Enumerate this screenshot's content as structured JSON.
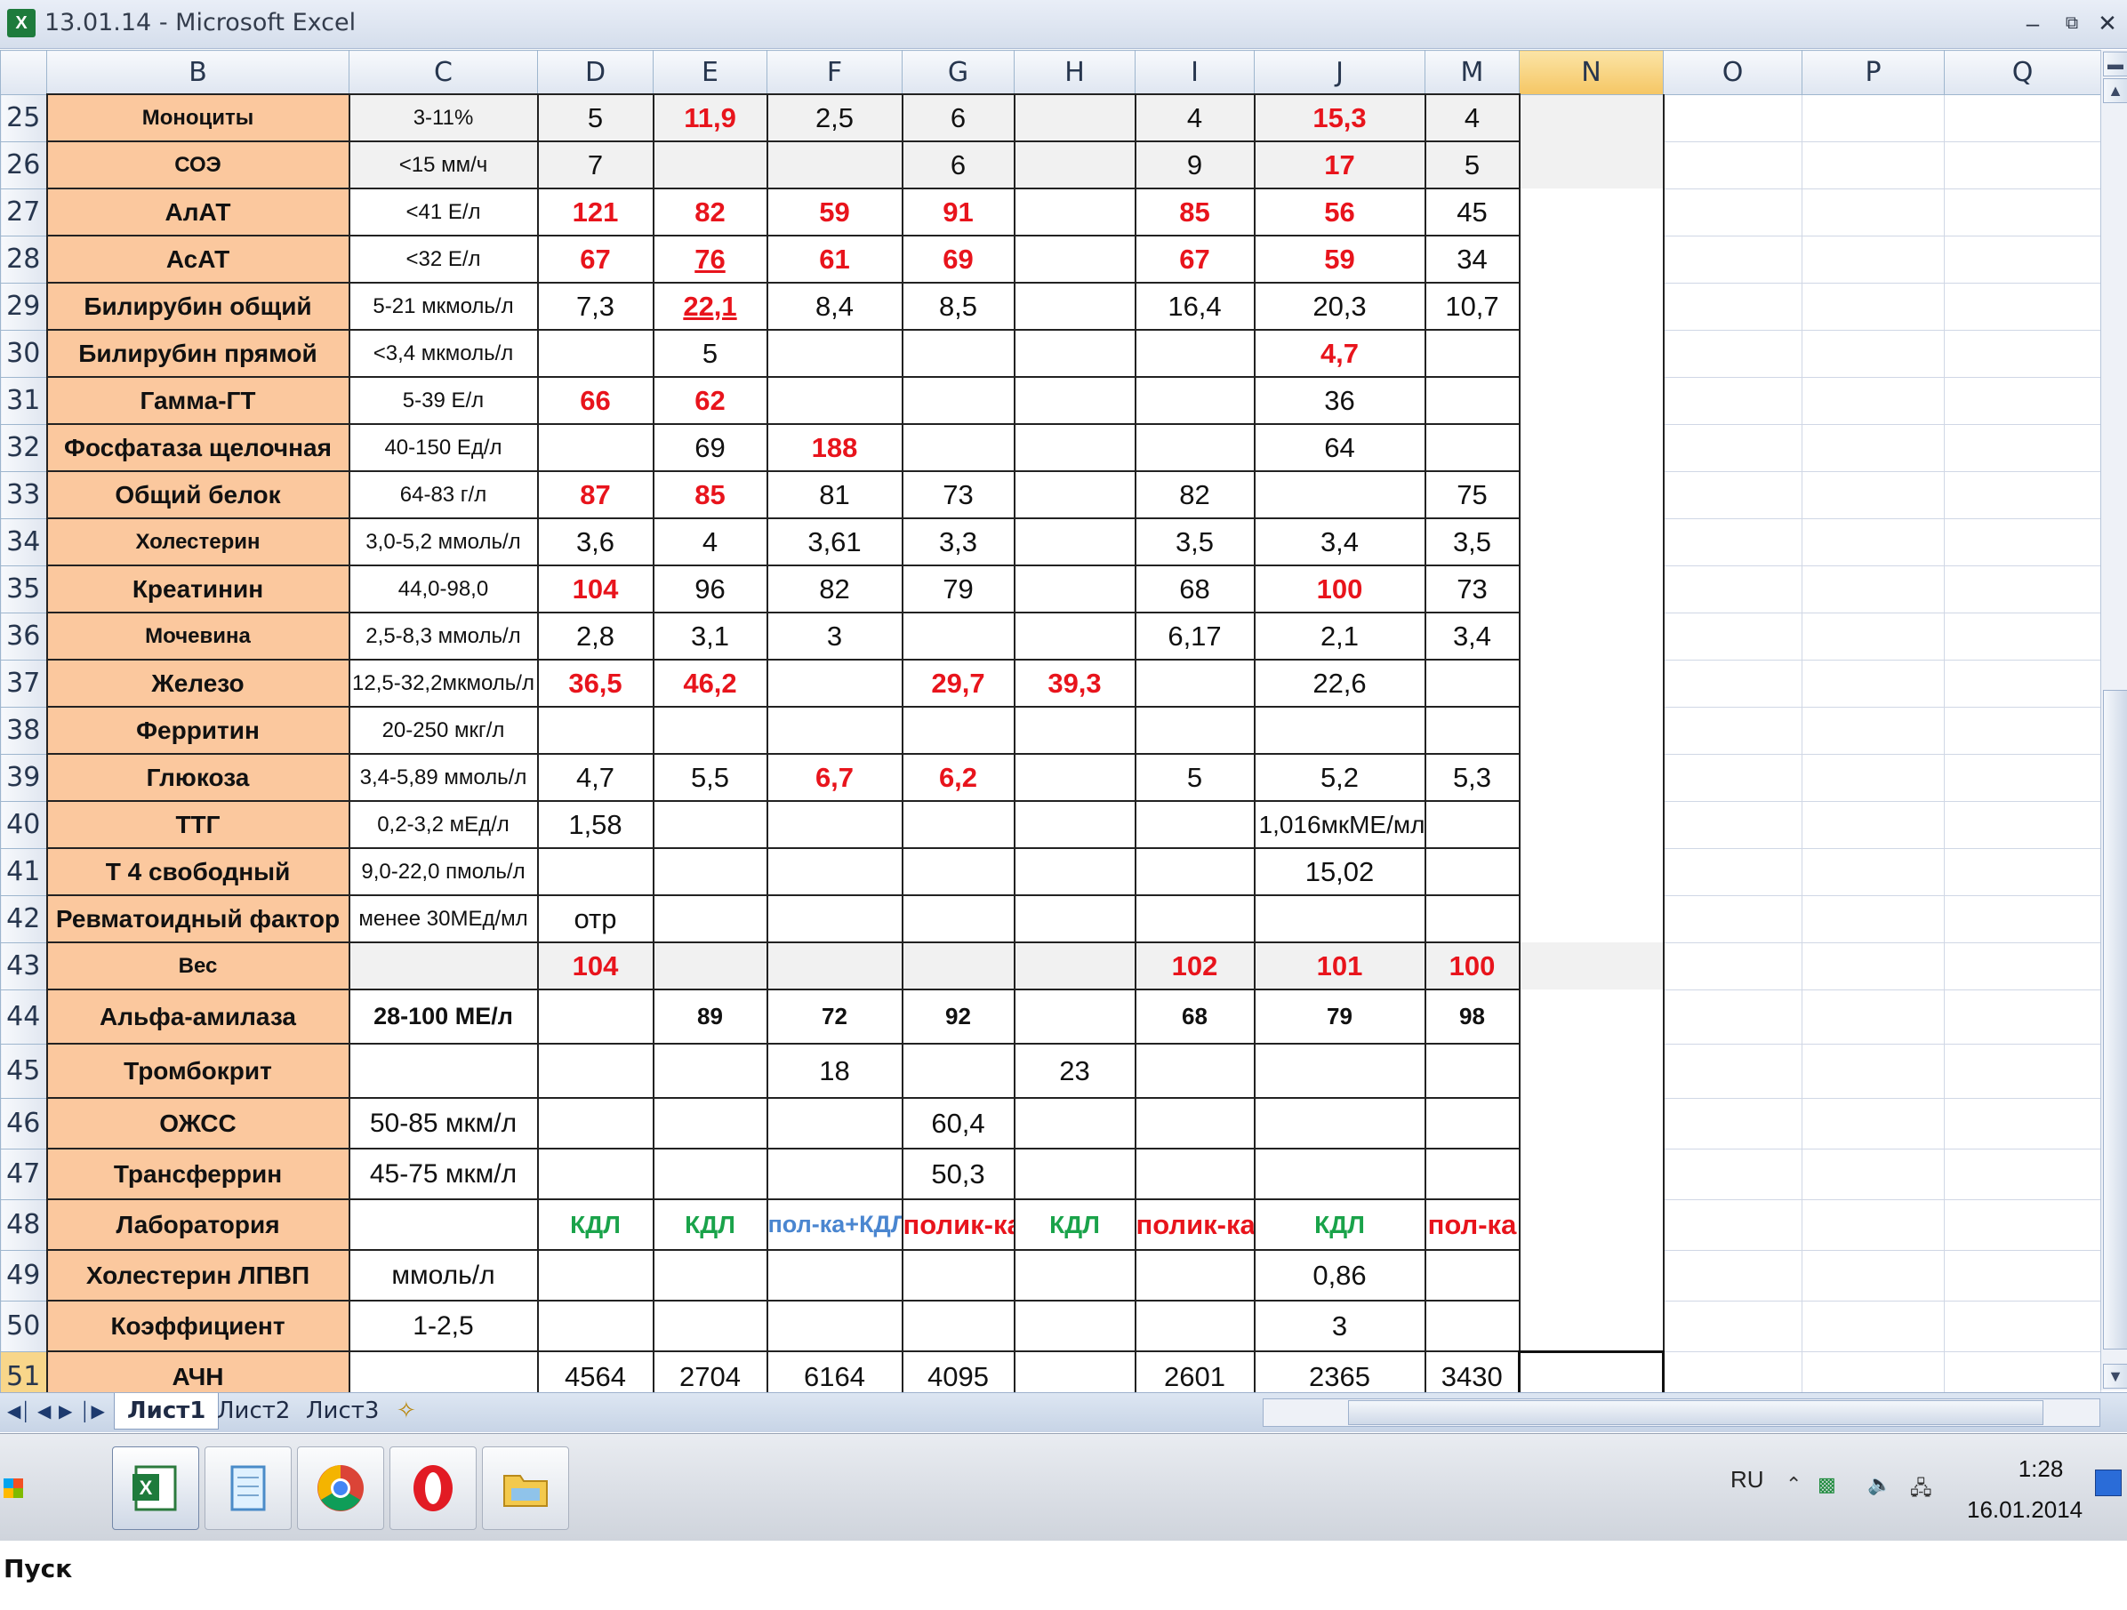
{
  "window": {
    "title": "13.01.14 - Microsoft Excel",
    "app_icon_glyph": "X"
  },
  "columns": [
    "B",
    "C",
    "D",
    "E",
    "F",
    "G",
    "H",
    "I",
    "J",
    "M",
    "N",
    "O",
    "P",
    "Q"
  ],
  "selected_column": "N",
  "selected_row": "51",
  "rows": [
    {
      "n": "25",
      "name": "Моноциты",
      "norm": "3-11%",
      "vals": [
        "5",
        "11,9",
        "2,5",
        "6",
        "",
        "4",
        "15,3",
        "4"
      ]
    },
    {
      "n": "26",
      "name": "СОЭ",
      "norm": "<15 мм/ч",
      "vals": [
        "7",
        "",
        "",
        "6",
        "",
        "9",
        "17",
        "5"
      ]
    },
    {
      "n": "27",
      "name": "АлАТ",
      "norm": "<41 Е/л",
      "vals": [
        "121",
        "82",
        "59",
        "91",
        "",
        "85",
        "56",
        "45"
      ]
    },
    {
      "n": "28",
      "name": "АсАТ",
      "norm": "<32 Е/л",
      "vals": [
        "67",
        "76",
        "61",
        "69",
        "",
        "67",
        "59",
        "34"
      ]
    },
    {
      "n": "29",
      "name": "Билирубин общий",
      "norm": "5-21 мкмоль/л",
      "vals": [
        "7,3",
        "22,1",
        "8,4",
        "8,5",
        "",
        "16,4",
        "20,3",
        "10,7"
      ]
    },
    {
      "n": "30",
      "name": "Билирубин прямой",
      "norm": "<3,4 мкмоль/л",
      "vals": [
        "",
        "5",
        "",
        "",
        "",
        "",
        "4,7",
        ""
      ]
    },
    {
      "n": "31",
      "name": "Гамма-ГТ",
      "norm": "5-39 Е/л",
      "vals": [
        "66",
        "62",
        "",
        "",
        "",
        "",
        "36",
        ""
      ]
    },
    {
      "n": "32",
      "name": "Фосфатаза щелочная",
      "norm": "40-150 Ед/л",
      "vals": [
        "",
        "69",
        "188",
        "",
        "",
        "",
        "64",
        ""
      ]
    },
    {
      "n": "33",
      "name": "Общий белок",
      "norm": "64-83 г/л",
      "vals": [
        "87",
        "85",
        "81",
        "73",
        "",
        "82",
        "",
        "75"
      ]
    },
    {
      "n": "34",
      "name": "Холестерин",
      "norm": "3,0-5,2 ммоль/л",
      "vals": [
        "3,6",
        "4",
        "3,61",
        "3,3",
        "",
        "3,5",
        "3,4",
        "3,5"
      ]
    },
    {
      "n": "35",
      "name": "Креатинин",
      "norm": "44,0-98,0",
      "vals": [
        "104",
        "96",
        "82",
        "79",
        "",
        "68",
        "100",
        "73"
      ]
    },
    {
      "n": "36",
      "name": "Мочевина",
      "norm": "2,5-8,3 ммоль/л",
      "vals": [
        "2,8",
        "3,1",
        "3",
        "",
        "",
        "6,17",
        "2,1",
        "3,4"
      ]
    },
    {
      "n": "37",
      "name": "Железо",
      "norm": "12,5-32,2мкмоль/л",
      "vals": [
        "36,5",
        "46,2",
        "",
        "29,7",
        "39,3",
        "",
        "22,6",
        ""
      ]
    },
    {
      "n": "38",
      "name": "Ферритин",
      "norm": "20-250 мкг/л",
      "vals": [
        "",
        "",
        "",
        "",
        "",
        "",
        "",
        ""
      ]
    },
    {
      "n": "39",
      "name": "Глюкоза",
      "norm": "3,4-5,89 ммоль/л",
      "vals": [
        "4,7",
        "5,5",
        "6,7",
        "6,2",
        "",
        "5",
        "5,2",
        "5,3"
      ]
    },
    {
      "n": "40",
      "name": "ТТГ",
      "norm": "0,2-3,2 мЕд/л",
      "vals": [
        "1,58",
        "",
        "",
        "",
        "",
        "",
        "1,016мкМЕ/мл",
        ""
      ]
    },
    {
      "n": "41",
      "name": "Т 4 свободный",
      "norm": "9,0-22,0 пмоль/л",
      "vals": [
        "",
        "",
        "",
        "",
        "",
        "",
        "15,02",
        ""
      ]
    },
    {
      "n": "42",
      "name": "Ревматоидный фактор",
      "norm": "менее 30МЕд/мл",
      "vals": [
        "отр",
        "",
        "",
        "",
        "",
        "",
        "",
        ""
      ]
    },
    {
      "n": "43",
      "name": "Вес",
      "norm": "",
      "vals": [
        "104",
        "",
        "",
        "",
        "",
        "102",
        "101",
        "100"
      ]
    },
    {
      "n": "44",
      "name": "Альфа-амилаза",
      "norm": "28-100 МЕ/л",
      "vals": [
        "",
        "89",
        "72",
        "92",
        "",
        "68",
        "79",
        "98"
      ]
    },
    {
      "n": "45",
      "name": "Тромбокрит",
      "norm": "",
      "vals": [
        "",
        "",
        "18",
        "",
        "23",
        "",
        "",
        ""
      ]
    },
    {
      "n": "46",
      "name": "ОЖСС",
      "norm": "50-85 мкм/л",
      "vals": [
        "",
        "",
        "",
        "60,4",
        "",
        "",
        "",
        ""
      ]
    },
    {
      "n": "47",
      "name": "Трансферрин",
      "norm": "45-75 мкм/л",
      "vals": [
        "",
        "",
        "",
        "50,3",
        "",
        "",
        "",
        ""
      ]
    },
    {
      "n": "48",
      "name": "Лаборатория",
      "norm": "",
      "vals": [
        "КДЛ",
        "КДЛ",
        "пол-ка+КДЛ",
        "полик-ка",
        "КДЛ",
        "полик-ка",
        "КДЛ",
        "пол-ка"
      ]
    },
    {
      "n": "49",
      "name": "Холестерин ЛПВП",
      "norm": "ммоль/л",
      "vals": [
        "",
        "",
        "",
        "",
        "",
        "",
        "0,86",
        ""
      ]
    },
    {
      "n": "50",
      "name": "Коэффициент",
      "norm": "1-2,5",
      "vals": [
        "",
        "",
        "",
        "",
        "",
        "",
        "3",
        ""
      ]
    },
    {
      "n": "51",
      "name": "АЧН",
      "norm": "",
      "vals": [
        "4564",
        "2704",
        "6164",
        "4095",
        "",
        "2601",
        "2365",
        "3430"
      ]
    }
  ],
  "colors": {
    "name_fill": "#fbc89e",
    "abnormal_red": "#e8141c",
    "lab_green": "#1aa34a",
    "lab_blue": "#4a86d0"
  },
  "sheets": [
    {
      "label": "Лист1",
      "active": true
    },
    {
      "label": "Лист2",
      "active": false
    },
    {
      "label": "Лист3",
      "active": false
    }
  ],
  "taskbar": {
    "start_label": "Пуск",
    "apps": [
      "excel-icon",
      "notepad-icon",
      "chrome-icon",
      "opera-icon",
      "folder-icon"
    ],
    "language": "RU",
    "time": "1:28",
    "date": "16.01.2014"
  }
}
